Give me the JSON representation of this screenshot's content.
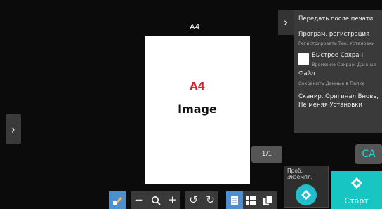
{
  "preview": {
    "paper_label": "A4",
    "paper_size_text": "A4",
    "paper_image_text": "Image",
    "page_counter": "1/1"
  },
  "menu": {
    "items": [
      {
        "title": "Передать после печати"
      },
      {
        "title": "Програм. регистрация",
        "subtitle": "Регистрировать Тек. Установки"
      },
      {
        "title": "Быстрое Сохран",
        "subtitle": "Временно Сохран. Данные"
      },
      {
        "title": "Файл",
        "subtitle": "Сохранить Данные в Папке"
      },
      {
        "title": "Сканир. Оригинал Вновь,",
        "title2": "Не меняя Установки"
      }
    ]
  },
  "buttons": {
    "ca": "CA",
    "preview_copy_line1": "Проб.",
    "preview_copy_line2": "Экземпл.",
    "start": "Старт"
  },
  "colors": {
    "accent": "#17c6c2",
    "start_bg": "#17c6c2",
    "ca_text": "#2ad0dc",
    "paper_size_red": "#e02020",
    "toolbar_blue": "#4f8fd0"
  },
  "icons": {
    "left_expand": "chevron-right-icon",
    "panel_toggle": "chevron-right-icon",
    "toolbar": [
      "edit-icon",
      "zoom-out-icon",
      "zoom-in-search-icon",
      "zoom-in-plus-icon",
      "rotate-left-icon",
      "rotate-right-icon",
      "single-page-view-icon",
      "multi-page-view-icon",
      "overlay-view-icon"
    ],
    "start": "diamond-start-icon"
  }
}
